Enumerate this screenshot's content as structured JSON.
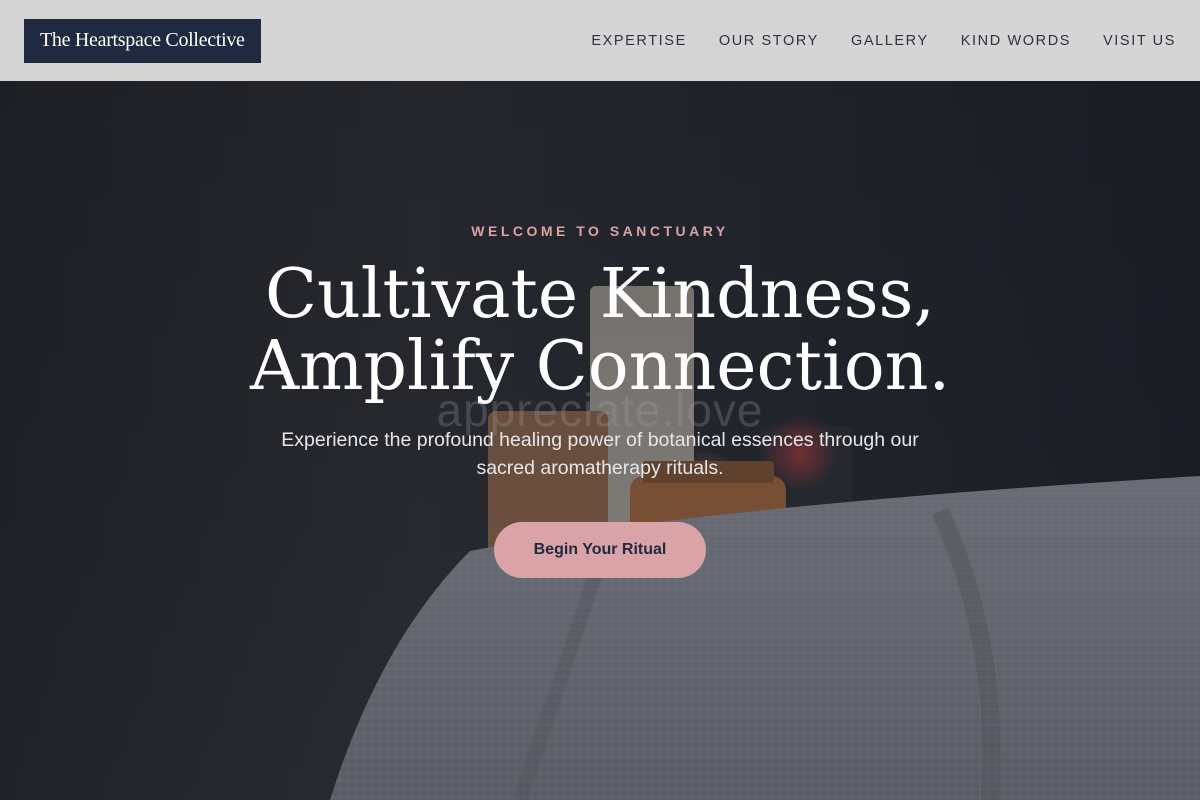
{
  "header": {
    "logo_text": "The Heartspace Collective",
    "nav": [
      {
        "label": "EXPERTISE"
      },
      {
        "label": "OUR STORY"
      },
      {
        "label": "GALLERY"
      },
      {
        "label": "KIND WORDS"
      },
      {
        "label": "VISIT US"
      }
    ]
  },
  "hero": {
    "eyebrow": "WELCOME TO SANCTUARY",
    "headline_line1": "Cultivate Kindness,",
    "headline_line2": "Amplify Connection.",
    "watermark": "appreciate.love",
    "subtitle": "Experience the profound healing power of botanical essences through our sacred aromatherapy rituals.",
    "cta_label": "Begin Your Ritual"
  },
  "colors": {
    "accent": "#d9a3a8",
    "navy": "#1f2a40",
    "nav_bg": "#d5d5d6"
  }
}
